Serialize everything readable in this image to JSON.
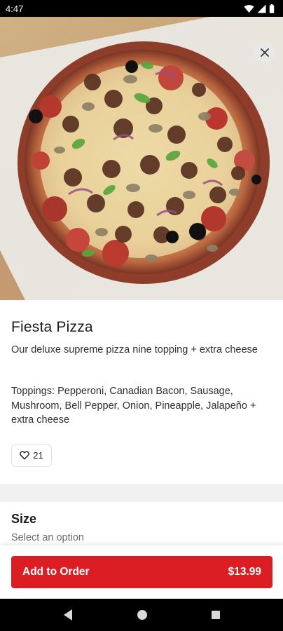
{
  "status_bar": {
    "time": "4:47",
    "icons": [
      "wifi-icon",
      "cellular-signal-icon",
      "battery-icon"
    ]
  },
  "hero": {
    "image_description_name": "pizza-photo",
    "close_icon": "close-icon"
  },
  "item": {
    "name": "Fiesta Pizza",
    "description": "Our deluxe supreme pizza nine topping + extra cheese",
    "toppings": "Toppings: Pepperoni, Canadian Bacon, Sausage, Mushroom, Bell Pepper, Onion, Pineapple, Jalapeño + extra cheese",
    "likes": "21",
    "like_icon": "heart-outline-icon"
  },
  "size_section": {
    "title": "Size",
    "subtitle": "Select an option"
  },
  "cart": {
    "button_label": "Add to Order",
    "price": "$13.99",
    "accent_color": "#db1d24"
  },
  "android_nav": {
    "back_icon": "back-triangle-icon",
    "home_icon": "home-circle-icon",
    "recents_icon": "recents-square-icon"
  }
}
